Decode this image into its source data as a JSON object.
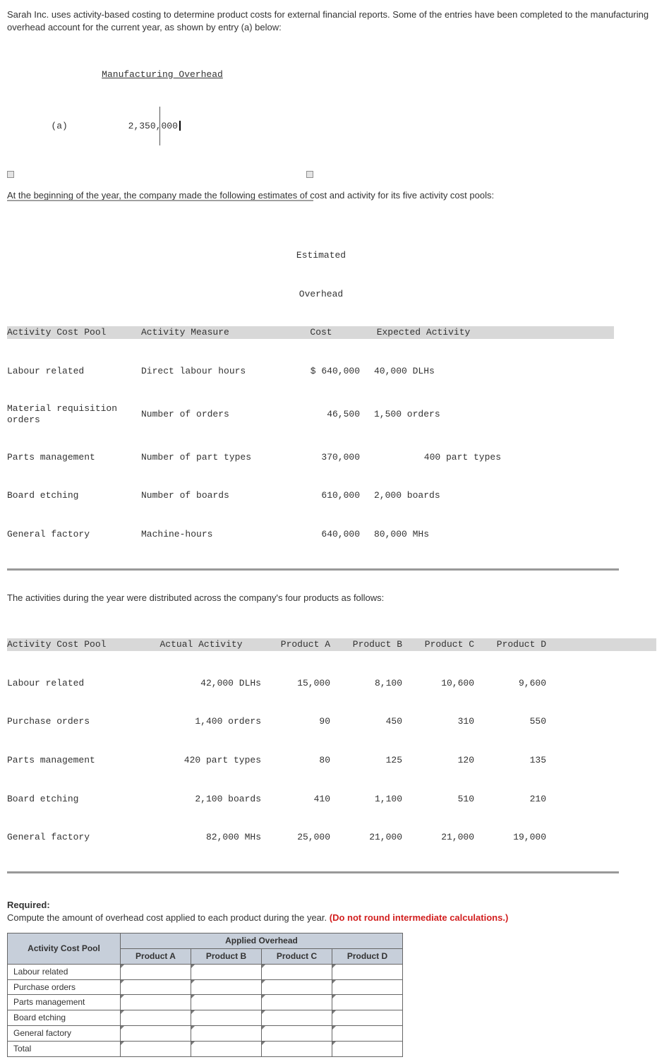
{
  "intro1": "Sarah Inc. uses activity-based costing to determine product costs for external financial reports. Some of the entries have been completed to the manufacturing overhead account for the current year, as shown by entry (a) below:",
  "mfg": {
    "title": "Manufacturing Overhead",
    "entry_label": "(a)",
    "entry_value": "2,350,000"
  },
  "intro2": "At the beginning of the year, the company made the following estimates of cost and activity for its five activity cost pools:",
  "table1": {
    "h": {
      "c1": "Activity Cost Pool",
      "c2": "Activity Measure",
      "c3a": "Estimated",
      "c3b": "Overhead",
      "c3c": "Cost",
      "c4": "Expected Activity"
    },
    "r1": {
      "c1": "Labour related",
      "c2": "Direct labour hours",
      "c3": "$ 640,000",
      "c4": "40,000 DLHs"
    },
    "r2": {
      "c1": "Material requisition orders",
      "c2": "Number of orders",
      "c3": "46,500",
      "c4": "1,500 orders"
    },
    "r3": {
      "c1": "Parts management",
      "c2": "Number of part types",
      "c3": "370,000",
      "c4": "400 part types"
    },
    "r4": {
      "c1": "Board etching",
      "c2": "Number of boards",
      "c3": "610,000",
      "c4": "2,000 boards"
    },
    "r5": {
      "c1": "General factory",
      "c2": "Machine-hours",
      "c3": "640,000",
      "c4": "80,000 MHs"
    }
  },
  "intro3": "The activities during the year were distributed across the company's four products as follows:",
  "table2": {
    "h": {
      "c1": "Activity Cost Pool",
      "c2": "Actual Activity",
      "pA": "Product A",
      "pB": "Product B",
      "pC": "Product C",
      "pD": "Product D"
    },
    "r1": {
      "c1": "Labour related",
      "c2": "42,000 DLHs",
      "pA": "15,000",
      "pB": "8,100",
      "pC": "10,600",
      "pD": "9,600"
    },
    "r2": {
      "c1": "Purchase orders",
      "c2": "1,400 orders",
      "pA": "90",
      "pB": "450",
      "pC": "310",
      "pD": "550"
    },
    "r3": {
      "c1": "Parts management",
      "c2": "420 part types",
      "pA": "80",
      "pB": "125",
      "pC": "120",
      "pD": "135"
    },
    "r4": {
      "c1": "Board etching",
      "c2": "2,100 boards",
      "pA": "410",
      "pB": "1,100",
      "pC": "510",
      "pD": "210"
    },
    "r5": {
      "c1": "General factory",
      "c2": "82,000 MHs",
      "pA": "25,000",
      "pB": "21,000",
      "pC": "21,000",
      "pD": "19,000"
    }
  },
  "required": {
    "label": "Required:",
    "text": "Compute the amount of overhead cost applied to each product during the year. ",
    "red": "(Do not round intermediate calculations.)"
  },
  "answer": {
    "span_header": "Applied Overhead",
    "col_activity": "Activity Cost Pool",
    "cols": {
      "pA": "Product A",
      "pB": "Product B",
      "pC": "Product C",
      "pD": "Product D"
    },
    "rows": {
      "r1": "Labour related",
      "r2": "Purchase orders",
      "r3": "Parts management",
      "r4": "Board etching",
      "r5": "General factory",
      "r6": "Total"
    }
  }
}
